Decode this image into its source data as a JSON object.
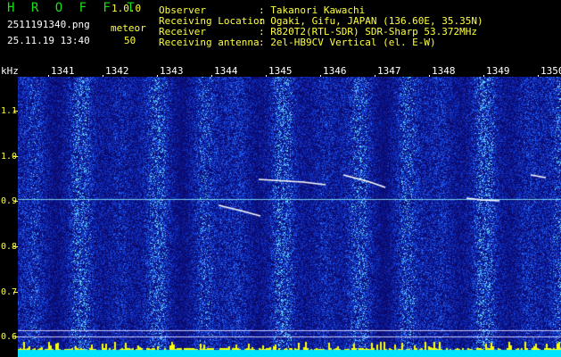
{
  "header": {
    "app_title": "H R O F F T",
    "version": "1.0.0",
    "file_name": "2511191340.png",
    "datetime": "25.11.19 13:40",
    "meteor_label": "meteor",
    "meteor_count": "50",
    "info_labels": "Observer\nReceiving Location\nReceiver\nReceiving antenna",
    "info_values": ": Takanori Kawachi\n: Ogaki, Gifu, JAPAN (136.60E, 35.35N)\n: R820T2(RTL-SDR) SDR-Sharp 53.372MHz\n: 2el-HB9CV Vertical (el. E-W)"
  },
  "axis": {
    "unit": "kHz",
    "time_ticks": [
      "1341",
      "1342",
      "1343",
      "1344",
      "1345",
      "1346",
      "1347",
      "1348",
      "1349",
      "1350"
    ],
    "freq_ticks": [
      "1.1",
      "1.0",
      "0.9",
      "0.8",
      "0.7",
      "0.6"
    ]
  },
  "colors": {
    "background": "#0a0a6e",
    "noise_mid": "#1c5cff",
    "noise_bright": "#6fe0ff",
    "signal": "#ffffff",
    "bottom_band": "#00e5ff",
    "bottom_peaks": "#ffff00",
    "grid_line": "#c8c8ff"
  }
}
